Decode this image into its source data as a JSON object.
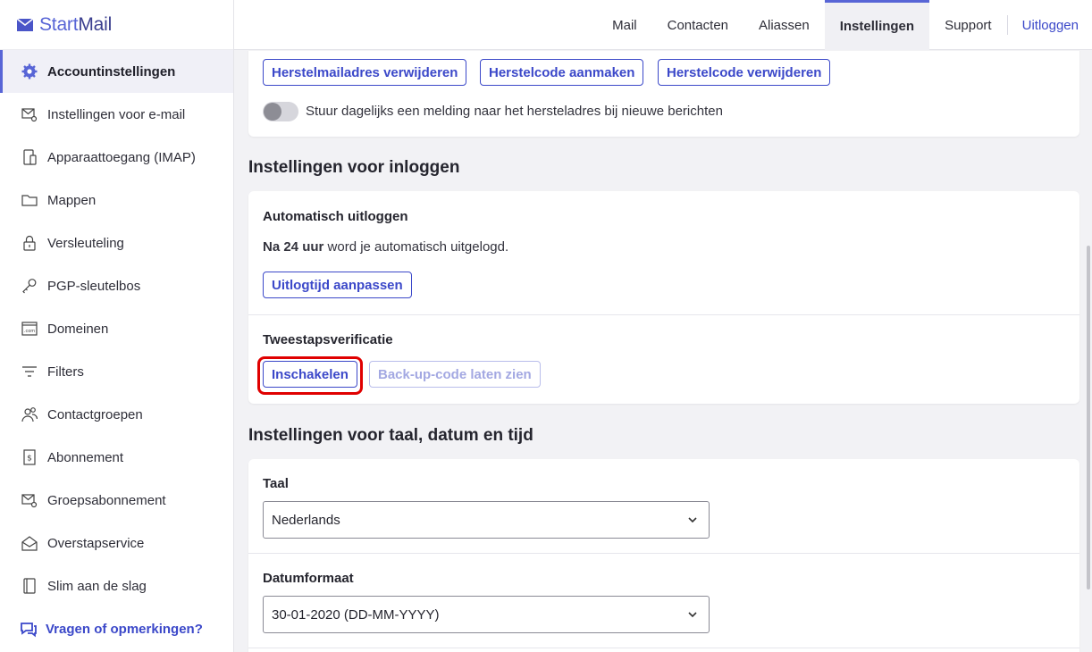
{
  "brand": {
    "part1": "Start",
    "part2": "Mail",
    "accent": "#5865d6"
  },
  "topnav": {
    "tabs": [
      {
        "label": "Mail"
      },
      {
        "label": "Contacten"
      },
      {
        "label": "Aliassen"
      },
      {
        "label": "Instellingen",
        "active": true
      },
      {
        "label": "Support"
      }
    ],
    "logout": "Uitloggen"
  },
  "sidebar": {
    "items": [
      {
        "label": "Accountinstellingen",
        "icon": "gear-icon",
        "active": true
      },
      {
        "label": "Instellingen voor e-mail",
        "icon": "mail-settings-icon"
      },
      {
        "label": "Apparaattoegang (IMAP)",
        "icon": "device-icon"
      },
      {
        "label": "Mappen",
        "icon": "folder-icon"
      },
      {
        "label": "Versleuteling",
        "icon": "lock-icon"
      },
      {
        "label": "PGP-sleutelbos",
        "icon": "key-icon"
      },
      {
        "label": "Domeinen",
        "icon": "domain-icon"
      },
      {
        "label": "Filters",
        "icon": "filter-icon"
      },
      {
        "label": "Contactgroepen",
        "icon": "contact-groups-icon"
      },
      {
        "label": "Abonnement",
        "icon": "subscription-icon"
      },
      {
        "label": "Groepsabonnement",
        "icon": "group-subscription-icon"
      },
      {
        "label": "Overstapservice",
        "icon": "migration-icon"
      },
      {
        "label": "Slim aan de slag",
        "icon": "getting-started-icon"
      }
    ],
    "help": {
      "label": "Vragen of opmerkingen?",
      "icon": "chat-icon"
    }
  },
  "recovery": {
    "buttons": [
      "Herstelmailadres verwijderen",
      "Herstelcode aanmaken",
      "Herstelcode verwijderen"
    ],
    "toggle_label": "Stuur dagelijks een melding naar het hersteladres bij nieuwe berichten",
    "toggle_on": false
  },
  "login": {
    "title": "Instellingen voor inloggen",
    "autologout": {
      "label": "Automatisch uitloggen",
      "text_bold": "Na 24 uur",
      "text_rest": " word je automatisch uitgelogd.",
      "button": "Uitlogtijd aanpassen"
    },
    "twofactor": {
      "label": "Tweestapsverificatie",
      "enable_button": "Inschakelen",
      "backup_button": "Back-up-code laten zien"
    }
  },
  "locale": {
    "title": "Instellingen voor taal, datum en tijd",
    "language": {
      "label": "Taal",
      "value": "Nederlands"
    },
    "dateformat": {
      "label": "Datumformaat",
      "value": "30-01-2020 (DD-MM-YYYY)"
    }
  },
  "colors": {
    "link": "#3b48c9",
    "highlight": "#e00000"
  }
}
